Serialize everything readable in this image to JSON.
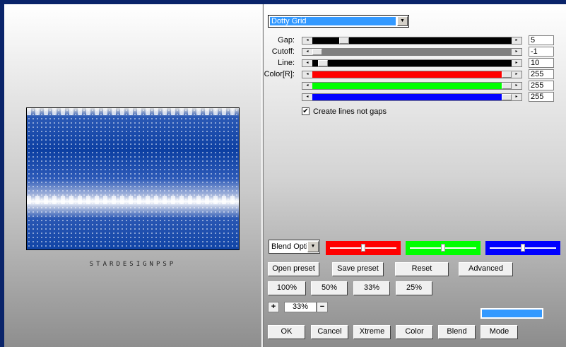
{
  "filter": {
    "preset_value": "Dotty Grid"
  },
  "preview": {
    "caption": "STARDESIGNPSP"
  },
  "sliders": [
    {
      "label": "Gap:",
      "value": "5",
      "fill": "#000000",
      "level": 0.14
    },
    {
      "label": "Cutoff:",
      "value": "-1",
      "fill": "#808080",
      "level": 0.0
    },
    {
      "label": "Line:",
      "value": "10",
      "fill": "#000000",
      "level": 0.03
    },
    {
      "label": "Color[R]:",
      "value": "255",
      "fill": "#ff0000",
      "level": 1.0
    },
    {
      "label": "",
      "value": "255",
      "fill": "#00ff00",
      "level": 1.0
    },
    {
      "label": "",
      "value": "255",
      "fill": "#0000ff",
      "level": 1.0
    }
  ],
  "checkbox": {
    "label": "Create lines not gaps",
    "checked": true,
    "mark": "✔"
  },
  "blend": {
    "select_value": "Blend Options",
    "colors": [
      {
        "name": "red",
        "color": "#ff0000",
        "level": 0.5
      },
      {
        "name": "green",
        "color": "#00ff00",
        "level": 0.5
      },
      {
        "name": "blue",
        "color": "#0000ff",
        "level": 0.5
      }
    ]
  },
  "buttons": {
    "open_preset": "Open preset",
    "save_preset": "Save preset",
    "reset": "Reset",
    "advanced": "Advanced",
    "z100": "100%",
    "z50": "50%",
    "z33": "33%",
    "z25": "25%",
    "ok": "OK",
    "cancel": "Cancel",
    "xtreme": "Xtreme",
    "color": "Color",
    "blend": "Blend",
    "mode": "Mode"
  },
  "zoom": {
    "plus": "+",
    "value": "33%",
    "minus": "−"
  },
  "accent": {
    "swatch_color": "#3399ff"
  }
}
